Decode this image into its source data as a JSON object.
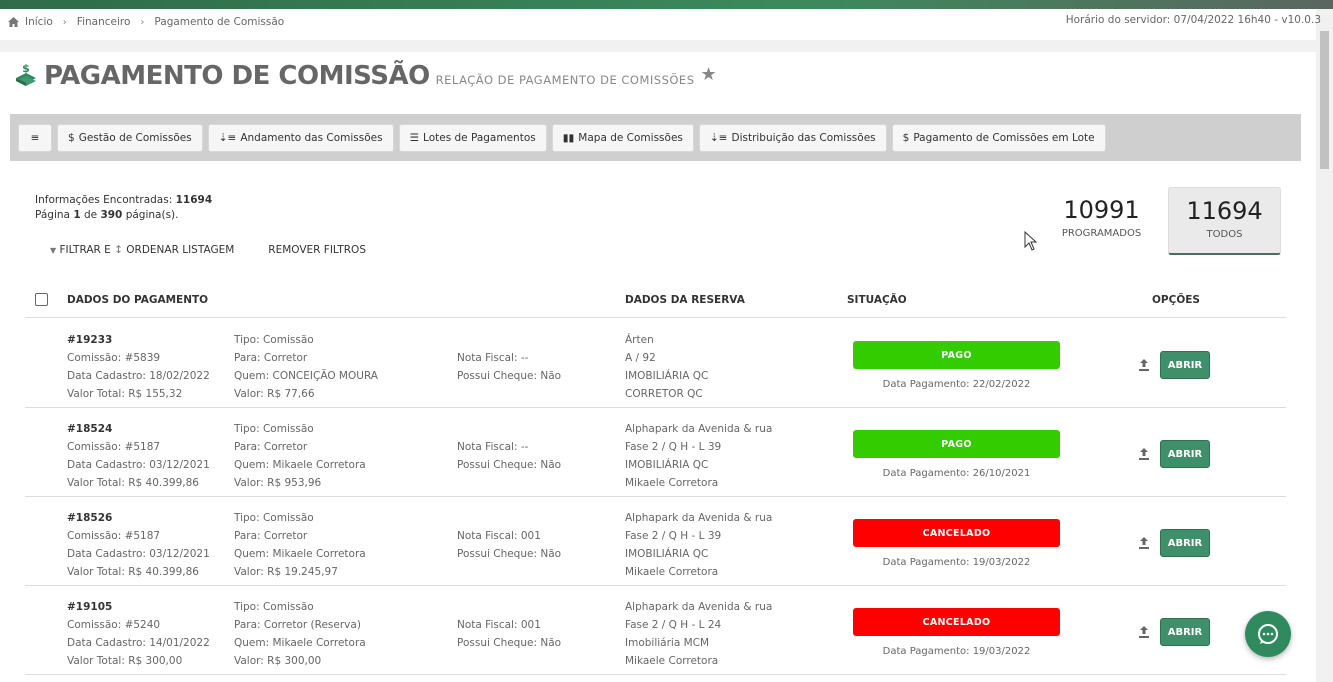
{
  "breadcrumb": {
    "home": "Início",
    "level1": "Financeiro",
    "level2": "Pagamento de Comissão"
  },
  "server_time": "Horário do servidor: 07/04/2022 16h40 - v10.0.3",
  "header": {
    "title": "PAGAMENTO DE COMISSÃO",
    "subtitle": "RELAÇÃO DE PAGAMENTO DE COMISSÕES"
  },
  "toolbar": {
    "menu_icon": "≡",
    "buttons": [
      {
        "icon": "$",
        "label": "Gestão de Comissões"
      },
      {
        "icon": "⇣≡",
        "label": "Andamento das Comissões"
      },
      {
        "icon": "☰",
        "label": "Lotes de Pagamentos"
      },
      {
        "icon": "▮▮",
        "label": "Mapa de Comissões"
      },
      {
        "icon": "⇣≡",
        "label": "Distribuição das Comissões"
      },
      {
        "icon": "$",
        "label": "Pagamento de Comissões em Lote"
      }
    ]
  },
  "info": {
    "found_label": "Informações Encontradas:",
    "found_value": "11694",
    "page_prefix": "Página",
    "page_current": "1",
    "page_of": "de",
    "page_total": "390",
    "page_suffix": "página(s)."
  },
  "filters": {
    "filter_label": "FILTRAR E",
    "order_label": "ORDENAR LISTAGEM",
    "remove_label": "REMOVER FILTROS"
  },
  "counters": [
    {
      "value": "10991",
      "label": "PROGRAMADOS"
    },
    {
      "value": "11694",
      "label": "TODOS"
    }
  ],
  "table": {
    "headers": {
      "payment": "DADOS DO PAGAMENTO",
      "reserve": "DADOS DA RESERVA",
      "status": "SITUAÇÃO",
      "options": "OPÇÕES"
    },
    "open_label": "ABRIR",
    "rows": [
      {
        "id": "#19233",
        "commission": "Comissão: #5839",
        "created": "Data Cadastro: 18/02/2022",
        "total": "Valor Total: R$ 155,32",
        "type": "Tipo: Comissão",
        "to": "Para: Corretor",
        "who": "Quem: CONCEIÇÃO MOURA",
        "value": "Valor: R$ 77,66",
        "invoice": "Nota Fiscal: --",
        "check": "Possui Cheque: Não",
        "res1": "Árten",
        "res2": "A / 92",
        "res3": "IMOBILIÁRIA QC",
        "res4": "CORRETOR QC",
        "status": "PAGO",
        "status_type": "pago",
        "pay_date": "Data Pagamento: 22/02/2022"
      },
      {
        "id": "#18524",
        "commission": "Comissão: #5187",
        "created": "Data Cadastro: 03/12/2021",
        "total": "Valor Total: R$ 40.399,86",
        "type": "Tipo: Comissão",
        "to": "Para: Corretor",
        "who": "Quem: Mikaele Corretora",
        "value": "Valor: R$ 953,96",
        "invoice": "Nota Fiscal: --",
        "check": "Possui Cheque: Não",
        "res1": "Alphapark da Avenida & rua",
        "res2": "Fase 2 / Q H - L 39",
        "res3": "IMOBILIÁRIA QC",
        "res4": "Mikaele Corretora",
        "status": "PAGO",
        "status_type": "pago",
        "pay_date": "Data Pagamento: 26/10/2021"
      },
      {
        "id": "#18526",
        "commission": "Comissão: #5187",
        "created": "Data Cadastro: 03/12/2021",
        "total": "Valor Total: R$ 40.399,86",
        "type": "Tipo: Comissão",
        "to": "Para: Corretor",
        "who": "Quem: Mikaele Corretora",
        "value": "Valor: R$ 19.245,97",
        "invoice": "Nota Fiscal: 001",
        "check": "Possui Cheque: Não",
        "res1": "Alphapark da Avenida & rua",
        "res2": "Fase 2 / Q H - L 39",
        "res3": "IMOBILIÁRIA QC",
        "res4": "Mikaele Corretora",
        "status": "CANCELADO",
        "status_type": "cancelado",
        "pay_date": "Data Pagamento: 19/03/2022"
      },
      {
        "id": "#19105",
        "commission": "Comissão: #5240",
        "created": "Data Cadastro: 14/01/2022",
        "total": "Valor Total: R$ 300,00",
        "type": "Tipo: Comissão",
        "to": "Para: Corretor (Reserva)",
        "who": "Quem: Mikaele Corretora",
        "value": "Valor: R$ 300,00",
        "invoice": "Nota Fiscal: 001",
        "check": "Possui Cheque: Não",
        "res1": "Alphapark da Avenida & rua",
        "res2": "Fase 2 / Q H - L 24",
        "res3": "Imobiliária MCM",
        "res4": "Mikaele Corretora",
        "status": "CANCELADO",
        "status_type": "cancelado",
        "pay_date": "Data Pagamento: 19/03/2022"
      }
    ]
  },
  "colors": {
    "accent": "#3f8f6a",
    "paid": "#33cc00",
    "cancelled": "#ff0000"
  },
  "icons": {
    "home": "home-icon",
    "chevron": "chevron-right-icon",
    "star": "star-icon",
    "upload": "upload-icon",
    "chat": "chat-icon"
  }
}
